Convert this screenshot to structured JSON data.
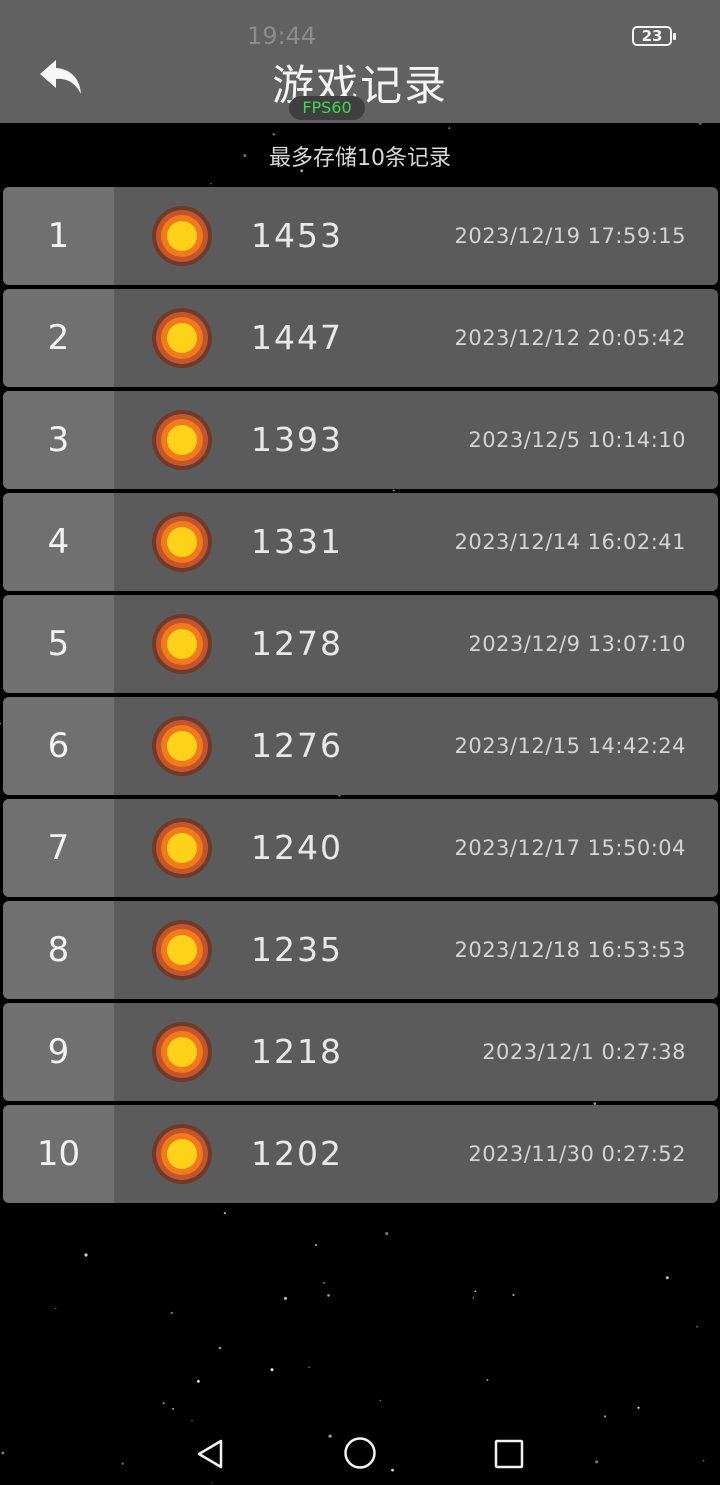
{
  "status_bar": {
    "time": "19:44",
    "battery": "23"
  },
  "header": {
    "title": "游戏记录",
    "fps_badge": "FPS60"
  },
  "subtitle": "最多存储10条记录",
  "records": [
    {
      "rank": "1",
      "score": "1453",
      "date": "2023/12/19 17:59:15"
    },
    {
      "rank": "2",
      "score": "1447",
      "date": "2023/12/12 20:05:42"
    },
    {
      "rank": "3",
      "score": "1393",
      "date": "2023/12/5 10:14:10"
    },
    {
      "rank": "4",
      "score": "1331",
      "date": "2023/12/14 16:02:41"
    },
    {
      "rank": "5",
      "score": "1278",
      "date": "2023/12/9 13:07:10"
    },
    {
      "rank": "6",
      "score": "1276",
      "date": "2023/12/15 14:42:24"
    },
    {
      "rank": "7",
      "score": "1240",
      "date": "2023/12/17 15:50:04"
    },
    {
      "rank": "8",
      "score": "1235",
      "date": "2023/12/18 16:53:53"
    },
    {
      "rank": "9",
      "score": "1218",
      "date": "2023/12/1 0:27:38"
    },
    {
      "rank": "10",
      "score": "1202",
      "date": "2023/11/30 0:27:52"
    }
  ],
  "icons": {
    "back": "back-arrow-icon",
    "record": "sun-icon",
    "nav_back": "triangle-back-icon",
    "nav_home": "circle-home-icon",
    "nav_recents": "square-recents-icon"
  },
  "colors": {
    "header_bg": "#616161",
    "row_bg": "#5b5b5b",
    "rank_bg": "#707070",
    "fps_text": "#3bd94b",
    "sun_core": "#ffd21a",
    "sun_ring": "#f07a1c"
  }
}
